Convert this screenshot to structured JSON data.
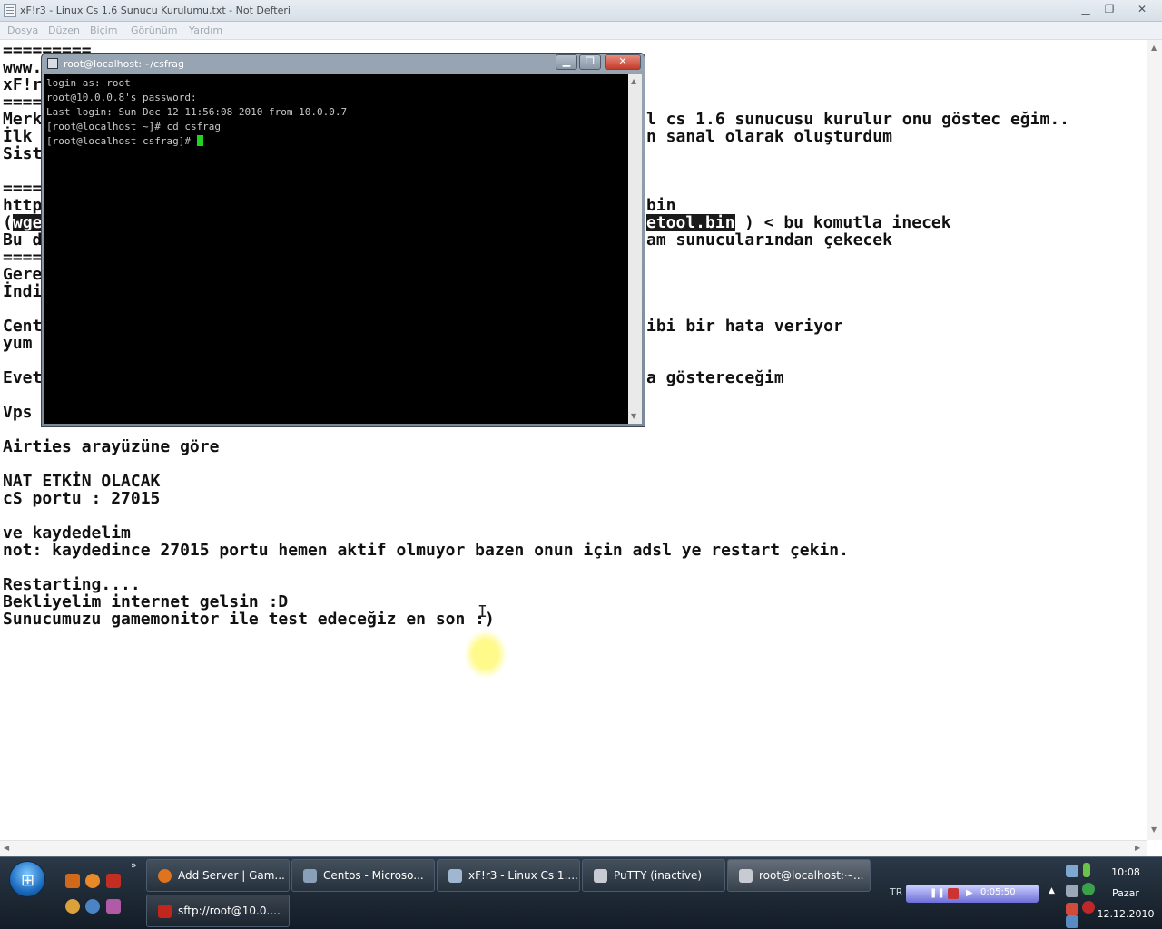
{
  "notepad": {
    "title": "xF!r3 - Linux Cs 1.6 Sunucu Kurulumu.txt - Not Defteri",
    "menu": [
      "Dosya",
      "Düzen",
      "Biçim",
      "Görünüm",
      "Yardım"
    ],
    "left_fragments": [
      "=========",
      "www.",
      "xF!r",
      "====",
      "Merk",
      "İlk",
      "Sist",
      "====",
      "http",
      "(",
      "wge",
      "Bu d",
      "====",
      "Gere",
      "İndi",
      "Cent",
      "yum",
      "Evet",
      "Vps"
    ],
    "right_fragments": [
      "l cs 1.6 sunucusu kurulur onu göstec eğim..",
      "n sanal olarak oluşturdum",
      "bin",
      "etool.bin",
      ") < bu komutla inecek",
      "am sunucularından çekecek",
      "ibi bir hata veriyor",
      "a göstereceğim"
    ],
    "lines": [
      "Airties arayüzüne göre",
      "NAT ETKİN OLACAK",
      "cS portu : 27015",
      "ve kaydedelim",
      "not: kaydedince 27015 portu hemen aktif olmuyor bazen onun için adsl ye restart çekin.",
      "Restarting....",
      "Bekliyelim internet gelsin :D",
      "Sunucumuzu gamemonitor ile test edeceğiz en son :)"
    ]
  },
  "putty": {
    "title": "root@localhost:~/csfrag",
    "terminal": [
      "login as: root",
      "root@10.0.0.8's password:",
      "Last login: Sun Dec 12 11:56:08 2010 from 10.0.0.7",
      "[root@localhost ~]# cd csfrag",
      "[root@localhost csfrag]# "
    ]
  },
  "taskbar": {
    "buttons": [
      {
        "label": "Add Server | Gam...",
        "icon": "firefox-icon",
        "color": "#e0741e"
      },
      {
        "label": "Centos - Microso...",
        "icon": "virtual-pc-icon",
        "color": "#8aa0b8"
      },
      {
        "label": "xF!r3 - Linux Cs 1....",
        "icon": "notepad-icon",
        "color": "#9fb7d0"
      },
      {
        "label": "PuTTY (inactive)",
        "icon": "putty-icon",
        "color": "#c8ccd2"
      },
      {
        "label": "root@localhost:~...",
        "icon": "putty-icon",
        "color": "#c8ccd2"
      },
      {
        "label": "sftp://root@10.0....",
        "icon": "filezilla-icon",
        "color": "#c0261c"
      }
    ],
    "language": "TR",
    "media_time": "0:05:50",
    "clock": {
      "time": "10:08",
      "day": "Pazar",
      "date": "12.12.2010"
    }
  }
}
